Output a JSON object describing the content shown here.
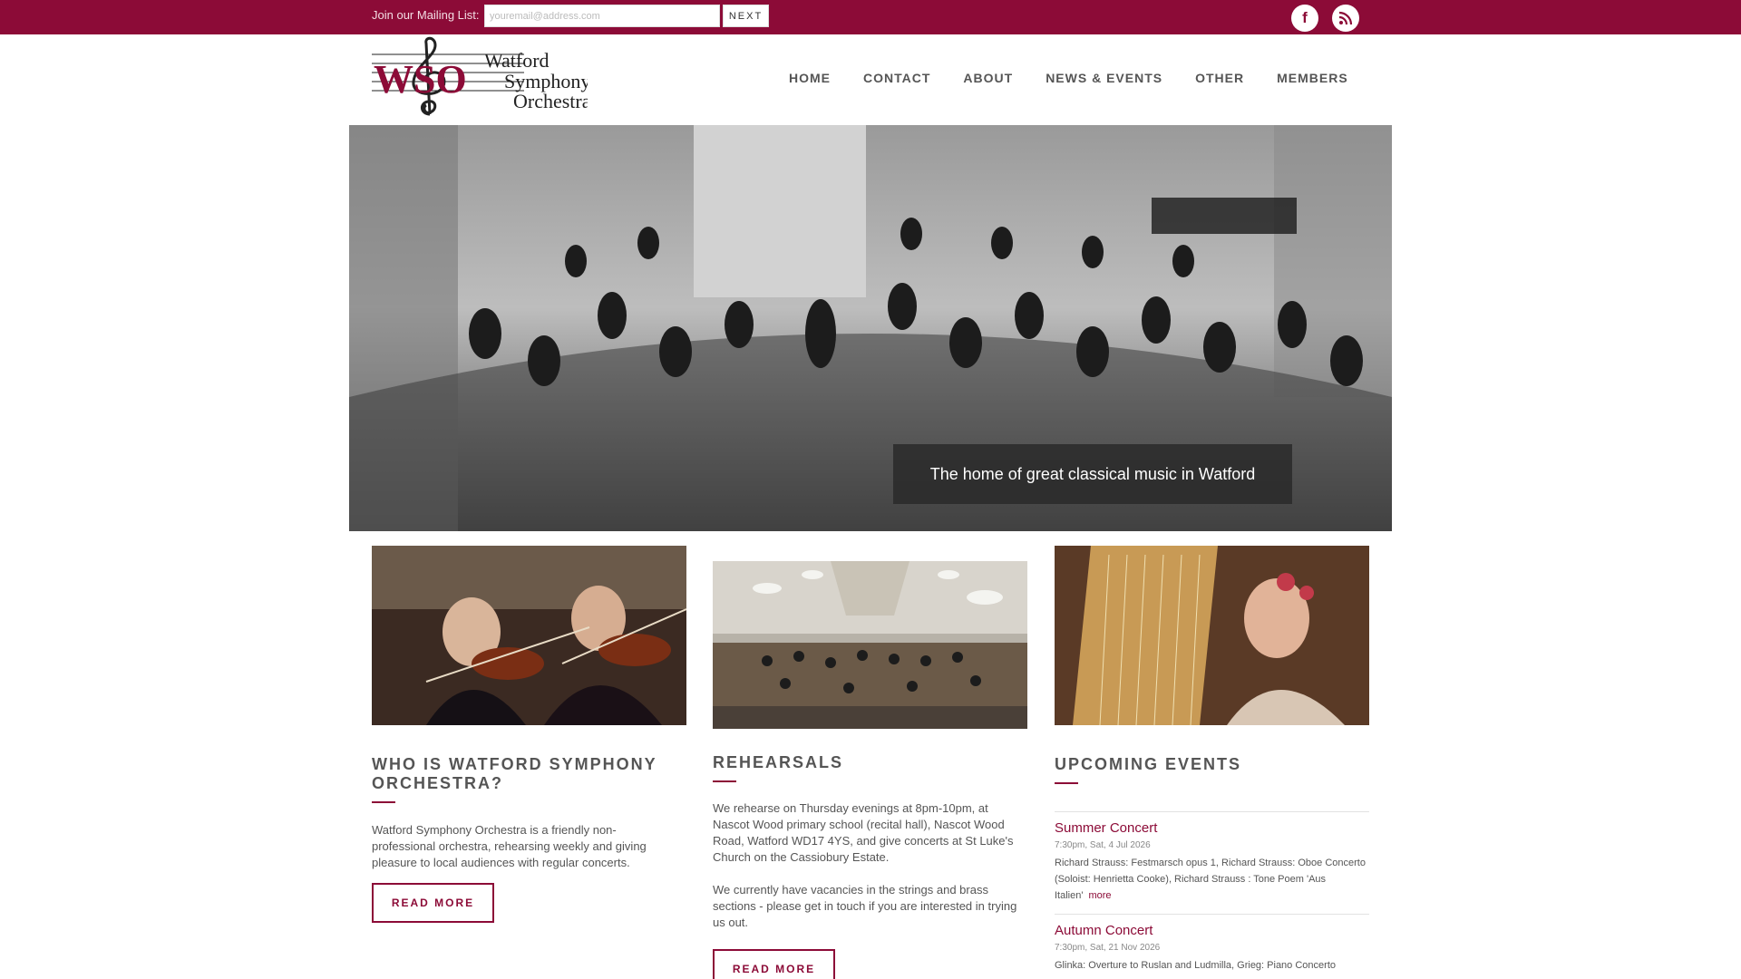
{
  "topbar": {
    "mailing_label": "Join our Mailing List:",
    "email_placeholder": "youremail@address.com",
    "next_label": "NEXT",
    "facebook_icon": "facebook-icon",
    "rss_icon": "rss-icon"
  },
  "logo": {
    "initials": "WSO",
    "line1": "Watford",
    "line2": "Symphony",
    "line3": "Orchestra"
  },
  "nav": {
    "items": [
      "HOME",
      "CONTACT",
      "ABOUT",
      "NEWS & EVENTS",
      "OTHER",
      "MEMBERS"
    ]
  },
  "hero": {
    "caption": "The home of great classical music in Watford"
  },
  "who": {
    "title": "WHO IS WATFORD SYMPHONY ORCHESTRA?",
    "text": "Watford Symphony Orchestra is a friendly non-professional orchestra, rehearsing weekly and giving pleasure to local audiences with regular concerts.",
    "button": "READ MORE"
  },
  "rehearsals": {
    "title": "REHEARSALS",
    "text1": "We rehearse on Thursday evenings at 8pm-10pm, at Nascot Wood primary school (recital hall), Nascot Wood Road, Watford WD17 4YS, and give concerts at St Luke's Church on the Cassiobury Estate.",
    "text2": "We currently have vacancies in the strings and brass sections - please get in touch if you are interested in trying us out.",
    "button": "READ MORE"
  },
  "events": {
    "title": "UPCOMING EVENTS",
    "items": [
      {
        "title": "Summer Concert",
        "date": "7:30pm, Sat, 4 Jul 2026",
        "desc": "Richard Strauss: Festmarsch opus 1, Richard Strauss: Oboe Concerto (Soloist: Henrietta Cooke), Richard Strauss : Tone Poem 'Aus Italien'",
        "more": "more"
      },
      {
        "title": "Autumn Concert",
        "date": "7:30pm, Sat, 21 Nov 2026",
        "desc": "Glinka: Overture to Ruslan and Ludmilla, Grieg: Piano Concerto"
      }
    ]
  },
  "colors": {
    "brand": "#8c0b37",
    "text": "#555555"
  }
}
